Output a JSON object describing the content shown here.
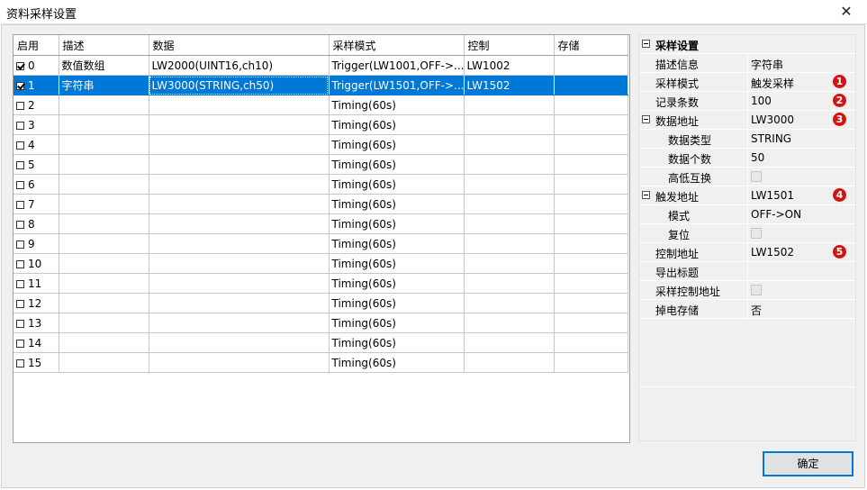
{
  "window": {
    "title": "资料采样设置",
    "close_glyph": "✕"
  },
  "grid": {
    "columns": [
      "启用",
      "描述",
      "数据",
      "采样模式",
      "控制",
      "存储"
    ],
    "rows": [
      {
        "enabled": true,
        "index": "0",
        "desc": "数值数组",
        "data": "LW2000(UINT16,ch10)",
        "mode": "Trigger(LW1001,OFF->...",
        "control": "LW1002",
        "storage": ""
      },
      {
        "enabled": true,
        "index": "1",
        "desc": "字符串",
        "data": "LW3000(STRING,ch50)",
        "mode": "Trigger(LW1501,OFF->...",
        "control": "LW1502",
        "storage": ""
      },
      {
        "enabled": false,
        "index": "2",
        "desc": "",
        "data": "",
        "mode": "Timing(60s)",
        "control": "",
        "storage": ""
      },
      {
        "enabled": false,
        "index": "3",
        "desc": "",
        "data": "",
        "mode": "Timing(60s)",
        "control": "",
        "storage": ""
      },
      {
        "enabled": false,
        "index": "4",
        "desc": "",
        "data": "",
        "mode": "Timing(60s)",
        "control": "",
        "storage": ""
      },
      {
        "enabled": false,
        "index": "5",
        "desc": "",
        "data": "",
        "mode": "Timing(60s)",
        "control": "",
        "storage": ""
      },
      {
        "enabled": false,
        "index": "6",
        "desc": "",
        "data": "",
        "mode": "Timing(60s)",
        "control": "",
        "storage": ""
      },
      {
        "enabled": false,
        "index": "7",
        "desc": "",
        "data": "",
        "mode": "Timing(60s)",
        "control": "",
        "storage": ""
      },
      {
        "enabled": false,
        "index": "8",
        "desc": "",
        "data": "",
        "mode": "Timing(60s)",
        "control": "",
        "storage": ""
      },
      {
        "enabled": false,
        "index": "9",
        "desc": "",
        "data": "",
        "mode": "Timing(60s)",
        "control": "",
        "storage": ""
      },
      {
        "enabled": false,
        "index": "10",
        "desc": "",
        "data": "",
        "mode": "Timing(60s)",
        "control": "",
        "storage": ""
      },
      {
        "enabled": false,
        "index": "11",
        "desc": "",
        "data": "",
        "mode": "Timing(60s)",
        "control": "",
        "storage": ""
      },
      {
        "enabled": false,
        "index": "12",
        "desc": "",
        "data": "",
        "mode": "Timing(60s)",
        "control": "",
        "storage": ""
      },
      {
        "enabled": false,
        "index": "13",
        "desc": "",
        "data": "",
        "mode": "Timing(60s)",
        "control": "",
        "storage": ""
      },
      {
        "enabled": false,
        "index": "14",
        "desc": "",
        "data": "",
        "mode": "Timing(60s)",
        "control": "",
        "storage": ""
      },
      {
        "enabled": false,
        "index": "15",
        "desc": "",
        "data": "",
        "mode": "Timing(60s)",
        "control": "",
        "storage": ""
      }
    ],
    "selected_row": "1"
  },
  "properties": {
    "group_sample": "采样设置",
    "desc_label": "描述信息",
    "desc_value": "字符串",
    "mode_label": "采样模式",
    "mode_value": "触发采样",
    "mode_badge": "1",
    "count_label": "记录条数",
    "count_value": "100",
    "count_badge": "2",
    "addr_label": "数据地址",
    "addr_value": "LW3000",
    "addr_badge": "3",
    "dtype_label": "数据类型",
    "dtype_value": "STRING",
    "dcount_label": "数据个数",
    "dcount_value": "50",
    "swap_label": "高低互换",
    "trig_label": "触发地址",
    "trig_value": "LW1501",
    "trig_badge": "4",
    "tmode_label": "模式",
    "tmode_value": "OFF->ON",
    "reset_label": "复位",
    "ctrl_label": "控制地址",
    "ctrl_value": "LW1502",
    "ctrl_badge": "5",
    "export_label": "导出标题",
    "sctrl_label": "采样控制地址",
    "power_label": "掉电存储",
    "power_value": "否"
  },
  "buttons": {
    "ok": "确定"
  },
  "colors": {
    "selection": "#0078d7",
    "badge": "#d01414"
  }
}
